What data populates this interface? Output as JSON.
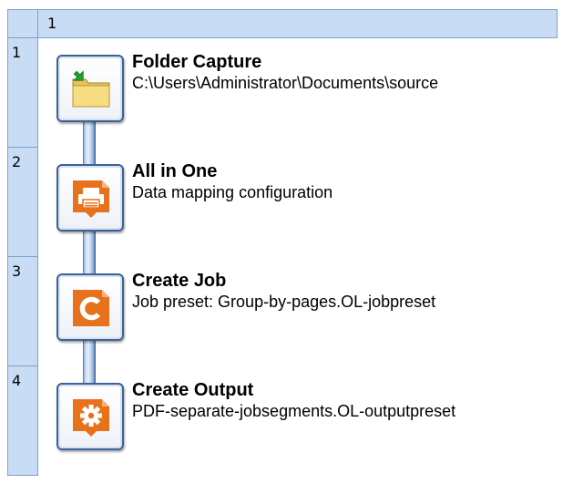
{
  "grid": {
    "column_header": "1",
    "row_headers": [
      "1",
      "2",
      "3",
      "4"
    ]
  },
  "colors": {
    "header_fill": "#c9dcf5",
    "header_border": "#7d9fcf",
    "plugin_orange": "#e8721c",
    "folder_yellow": "#f5d76e",
    "arrow_green": "#1fa02c",
    "tile_border": "#3d6296"
  },
  "steps": [
    {
      "icon": "folder-capture-icon",
      "title": "Folder Capture",
      "description": "C:\\Users\\Administrator\\Documents\\source"
    },
    {
      "icon": "all-in-one-icon",
      "title": "All in One",
      "description": "Data mapping configuration"
    },
    {
      "icon": "create-job-icon",
      "title": "Create Job",
      "description": "Job preset: Group-by-pages.OL-jobpreset"
    },
    {
      "icon": "create-output-icon",
      "title": "Create Output",
      "description": "PDF-separate-jobsegments.OL-outputpreset"
    }
  ]
}
